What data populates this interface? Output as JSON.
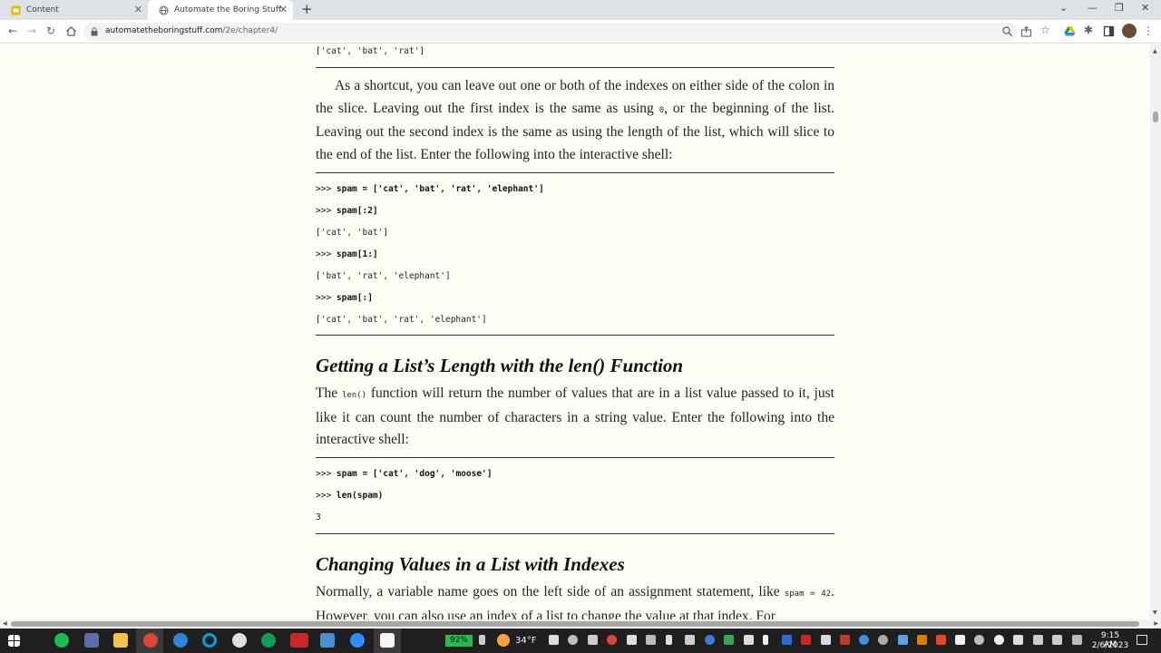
{
  "browser": {
    "tabs": [
      {
        "title": "Content",
        "icon": "slides-icon"
      },
      {
        "title": "Automate the Boring Stuff with Python",
        "icon": "globe-icon"
      }
    ],
    "new_tab_symbol": "+",
    "url_host": "automatetheboringstuff.com",
    "url_path": "/2e/chapter4/"
  },
  "page": {
    "code_top_output": "['cat', 'bat', 'rat']",
    "para1": {
      "before": "As a shortcut, you can leave out one or both of the indexes on either side of the colon in the slice. Leaving out the first index is the same as using ",
      "code": "0",
      "after": ", or the beginning of the list. Leaving out the second index is the same as using the length of the list, which will slice to the end of the list. Enter the following into the interactive shell:"
    },
    "code_block1": [
      {
        "prompt": ">>> ",
        "input": "spam = ['cat', 'bat', 'rat', 'elephant']"
      },
      {
        "prompt": ">>> ",
        "input": "spam[:2]"
      },
      {
        "output": "['cat', 'bat']"
      },
      {
        "prompt": ">>> ",
        "input": "spam[1:]"
      },
      {
        "output": "['bat', 'rat', 'elephant']"
      },
      {
        "prompt": ">>> ",
        "input": "spam[:]"
      },
      {
        "output": "['cat', 'bat', 'rat', 'elephant']"
      }
    ],
    "heading1": "Getting a List’s Length with the len() Function",
    "para2": {
      "before": "The ",
      "code": "len()",
      "after": " function will return the number of values that are in a list value passed to it, just like it can count the number of characters in a string value. Enter the following into the interactive shell:"
    },
    "code_block2": [
      {
        "prompt": ">>> ",
        "input": "spam = ['cat', 'dog', 'moose']"
      },
      {
        "prompt": ">>> ",
        "input": "len(spam)"
      },
      {
        "output": "3"
      }
    ],
    "heading2": "Changing Values in a List with Indexes",
    "para3": {
      "before": "Normally, a variable name goes on the left side of an assignment statement, like ",
      "code": "spam = 42",
      "after": ". However, you can also use an index of a list to change the value at that index. For"
    }
  },
  "taskbar": {
    "battery": "92%",
    "temperature": "34°F",
    "time": "9:15 AM",
    "date": "2/6/2023"
  },
  "colors": {
    "page_bg": "#fffff8",
    "taskbar_bg": "#1f1f1f",
    "battery_green": "#2db84d"
  }
}
